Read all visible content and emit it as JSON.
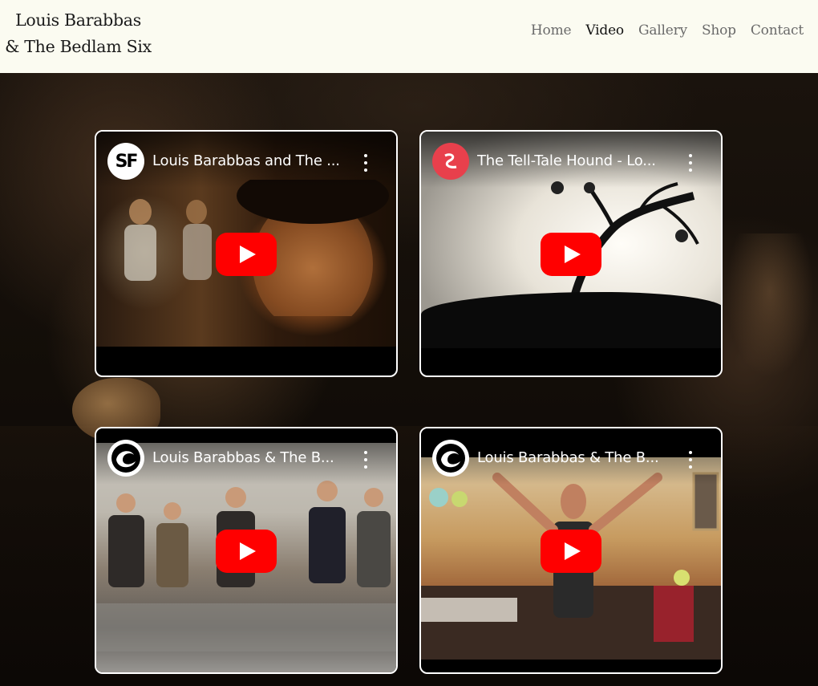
{
  "brand": {
    "line1": "Louis Barabbas",
    "line2": "& The Bedlam Six"
  },
  "nav": {
    "items": [
      {
        "label": "Home",
        "active": false
      },
      {
        "label": "Video",
        "active": true
      },
      {
        "label": "Gallery",
        "active": false
      },
      {
        "label": "Shop",
        "active": false
      },
      {
        "label": "Contact",
        "active": false
      }
    ]
  },
  "videos": [
    {
      "title": "Louis Barabbas and The ...",
      "channel_icon": "sf-logo-icon"
    },
    {
      "title": "The Tell-Tale Hound - Lo...",
      "channel_icon": "red-swirl-logo-icon"
    },
    {
      "title": "Louis Barabbas & The B...",
      "channel_icon": "wave-logo-icon"
    },
    {
      "title": "Louis Barabbas & The B...",
      "channel_icon": "wave-logo-icon"
    }
  ],
  "colors": {
    "header_bg": "#fbfbf1",
    "youtube_red": "#ff0000",
    "nav_text": "#6a6a6a",
    "nav_active": "#111111"
  }
}
